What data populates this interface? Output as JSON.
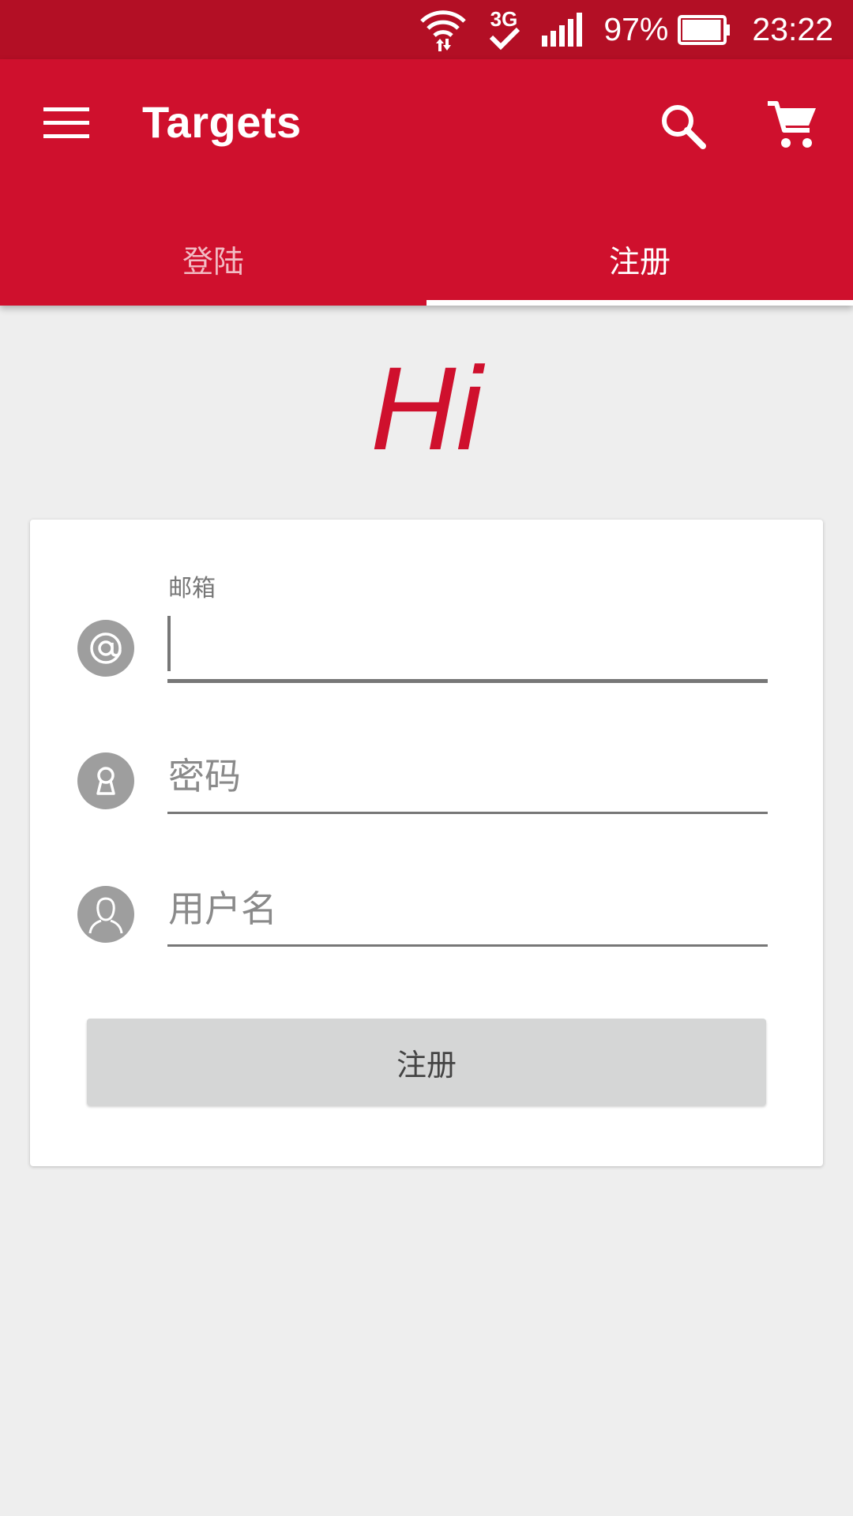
{
  "status_bar": {
    "network_type": "3G",
    "battery_percent": "97%",
    "battery_level": 0.97,
    "time": "23:22"
  },
  "toolbar": {
    "title": "Targets",
    "icons": [
      "menu-icon",
      "search-icon",
      "cart-icon"
    ]
  },
  "tabs": [
    {
      "label": "登陆",
      "active": false
    },
    {
      "label": "注册",
      "active": true
    }
  ],
  "greeting": "Hi",
  "form": {
    "email": {
      "label": "邮箱",
      "value": "",
      "icon": "at-icon"
    },
    "password": {
      "placeholder": "密码",
      "value": "",
      "icon": "keyhole-icon"
    },
    "username": {
      "placeholder": "用户名",
      "value": "",
      "icon": "user-icon"
    },
    "submit_label": "注册"
  },
  "colors": {
    "primary": "#cf102d",
    "status_bar": "#b30f25",
    "background": "#eeeeee",
    "icon_circle": "#9e9e9e",
    "button": "#d5d6d6"
  }
}
